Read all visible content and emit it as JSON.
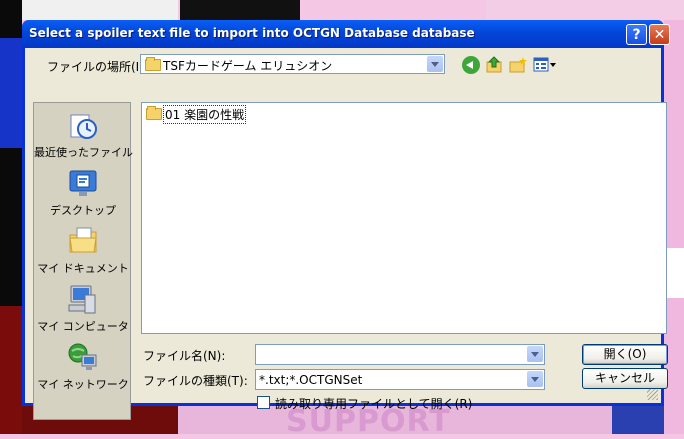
{
  "background": {
    "support_text": "SUPPORT"
  },
  "dialog": {
    "title": "Select a spoiler text file to import into OCTGN Database database",
    "help_button": "?",
    "close_button": "✕",
    "look_in": {
      "label": "ファイルの場所(I):",
      "value": "TSFカードゲーム エリュシオン"
    },
    "toolbar": {
      "back": "back-icon",
      "up": "up-folder-icon",
      "new_folder": "new-folder-icon",
      "view_menu": "view-menu-icon"
    },
    "places": [
      {
        "label": "最近使ったファイル",
        "icon": "recent-files-icon"
      },
      {
        "label": "デスクトップ",
        "icon": "desktop-icon"
      },
      {
        "label": "マイ ドキュメント",
        "icon": "my-documents-icon"
      },
      {
        "label": "マイ コンピュータ",
        "icon": "my-computer-icon"
      },
      {
        "label": "マイ ネットワーク",
        "icon": "my-network-icon"
      }
    ],
    "files": [
      {
        "name": "01 楽園の性戦",
        "type": "folder"
      }
    ],
    "file_name": {
      "label": "ファイル名(N):",
      "value": ""
    },
    "file_type": {
      "label": "ファイルの種類(T):",
      "value": "*.txt;*.OCTGNSet"
    },
    "open_button": "開く(O)",
    "cancel_button": "キャンセル",
    "read_only": {
      "label": "読み取り専用ファイルとして開く(R)",
      "checked": false
    }
  },
  "colors": {
    "titlebar": "#0346d8",
    "dialog_face": "#ece9d8",
    "places_bar": "#d6d2c2"
  }
}
